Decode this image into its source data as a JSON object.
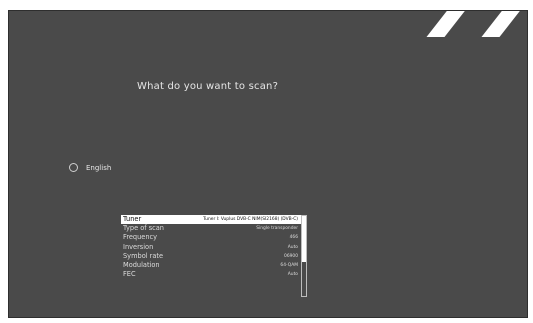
{
  "screen": {
    "question": "What do you want to scan?",
    "language_option": "English"
  },
  "scan_panel": {
    "rows": [
      {
        "key": "Tuner",
        "value": "Tuner I: Vuplus DVB-C NIM(SI2168) (DVB-C)",
        "selected": true
      },
      {
        "key": "Type of scan",
        "value": "Single transponder"
      },
      {
        "key": "Frequency",
        "value": "466"
      },
      {
        "key": "Inversion",
        "value": "Auto"
      },
      {
        "key": "Symbol rate",
        "value": "06900"
      },
      {
        "key": "Modulation",
        "value": "64-QAM"
      },
      {
        "key": "FEC",
        "value": "Auto"
      }
    ],
    "scroll_position": 0.56
  },
  "colors": {
    "background": "#4a4a4a",
    "text": "#e6e6e6",
    "selected_row": "#ffffff"
  }
}
